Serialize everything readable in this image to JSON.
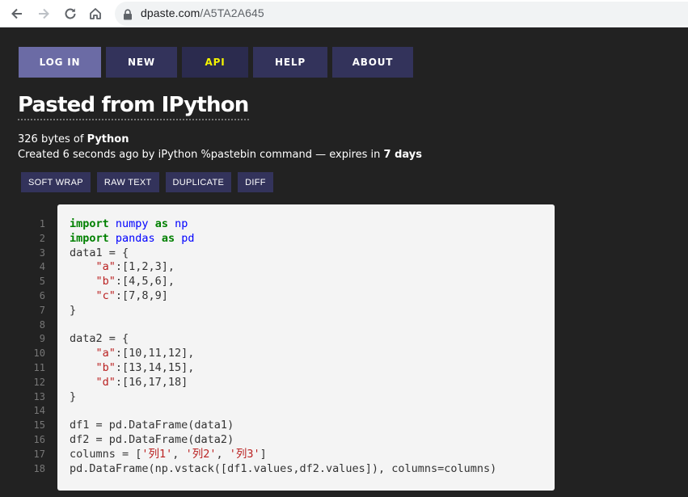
{
  "browser": {
    "url_host": "dpaste.com",
    "url_path": "/A5TA2A645"
  },
  "nav": {
    "login": "LOG IN",
    "new": "NEW",
    "api": "API",
    "help": "HELP",
    "about": "ABOUT"
  },
  "title": "Pasted from IPython",
  "meta": {
    "bytes": "326 bytes of",
    "language": "Python",
    "created": "Created 6 seconds ago by iPython %pastebin command — expires in",
    "expires": "7 days"
  },
  "actions": {
    "soft_wrap": "SOFT WRAP",
    "raw_text": "RAW TEXT",
    "duplicate": "DUPLICATE",
    "diff": "DIFF"
  },
  "line_numbers": [
    "1",
    "2",
    "3",
    "4",
    "5",
    "6",
    "7",
    "8",
    "9",
    "10",
    "11",
    "12",
    "13",
    "14",
    "15",
    "16",
    "17",
    "18"
  ],
  "code_lines": [
    [
      {
        "t": "import",
        "c": "kw"
      },
      {
        "t": " ",
        "c": "plain"
      },
      {
        "t": "numpy",
        "c": "nm"
      },
      {
        "t": " ",
        "c": "plain"
      },
      {
        "t": "as",
        "c": "kw"
      },
      {
        "t": " ",
        "c": "plain"
      },
      {
        "t": "np",
        "c": "nm"
      }
    ],
    [
      {
        "t": "import",
        "c": "kw"
      },
      {
        "t": " ",
        "c": "plain"
      },
      {
        "t": "pandas",
        "c": "nm"
      },
      {
        "t": " ",
        "c": "plain"
      },
      {
        "t": "as",
        "c": "kw"
      },
      {
        "t": " ",
        "c": "plain"
      },
      {
        "t": "pd",
        "c": "nm"
      }
    ],
    [
      {
        "t": "data1 = {",
        "c": "plain"
      }
    ],
    [
      {
        "t": "    ",
        "c": "plain"
      },
      {
        "t": "\"a\"",
        "c": "str"
      },
      {
        "t": ":[1,2,3],",
        "c": "plain"
      }
    ],
    [
      {
        "t": "    ",
        "c": "plain"
      },
      {
        "t": "\"b\"",
        "c": "str"
      },
      {
        "t": ":[4,5,6],",
        "c": "plain"
      }
    ],
    [
      {
        "t": "    ",
        "c": "plain"
      },
      {
        "t": "\"c\"",
        "c": "str"
      },
      {
        "t": ":[7,8,9]",
        "c": "plain"
      }
    ],
    [
      {
        "t": "}",
        "c": "plain"
      }
    ],
    [
      {
        "t": "",
        "c": "plain"
      }
    ],
    [
      {
        "t": "data2 = {",
        "c": "plain"
      }
    ],
    [
      {
        "t": "    ",
        "c": "plain"
      },
      {
        "t": "\"a\"",
        "c": "str"
      },
      {
        "t": ":[10,11,12],",
        "c": "plain"
      }
    ],
    [
      {
        "t": "    ",
        "c": "plain"
      },
      {
        "t": "\"b\"",
        "c": "str"
      },
      {
        "t": ":[13,14,15],",
        "c": "plain"
      }
    ],
    [
      {
        "t": "    ",
        "c": "plain"
      },
      {
        "t": "\"d\"",
        "c": "str"
      },
      {
        "t": ":[16,17,18]",
        "c": "plain"
      }
    ],
    [
      {
        "t": "}",
        "c": "plain"
      }
    ],
    [
      {
        "t": "",
        "c": "plain"
      }
    ],
    [
      {
        "t": "df1 = pd.DataFrame(data1)",
        "c": "plain"
      }
    ],
    [
      {
        "t": "df2 = pd.DataFrame(data2)",
        "c": "plain"
      }
    ],
    [
      {
        "t": "columns = [",
        "c": "plain"
      },
      {
        "t": "'列1'",
        "c": "str"
      },
      {
        "t": ", ",
        "c": "plain"
      },
      {
        "t": "'列2'",
        "c": "str"
      },
      {
        "t": ", ",
        "c": "plain"
      },
      {
        "t": "'列3'",
        "c": "str"
      },
      {
        "t": "]",
        "c": "plain"
      }
    ],
    [
      {
        "t": "pd.DataFrame(np.vstack([df1.values,df2.values]), columns=columns)",
        "c": "plain"
      }
    ]
  ],
  "colors": {
    "page_bg": "#222222",
    "nav_bg": "#33335b",
    "login_bg": "#6b6ba5",
    "api_text": "#f4f400",
    "code_bg": "#f4f4f4",
    "keyword": "#008000",
    "name": "#0000ff",
    "string": "#ba2121"
  }
}
